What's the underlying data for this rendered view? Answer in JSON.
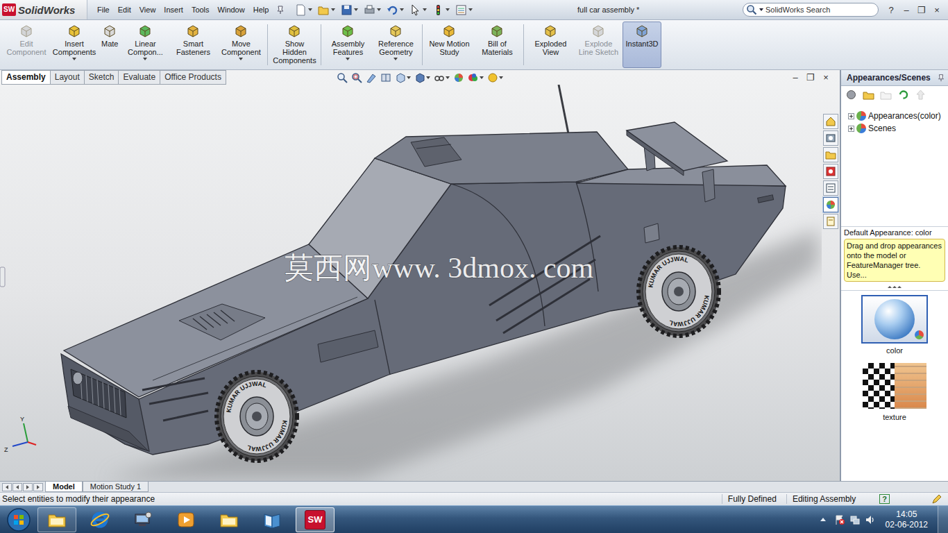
{
  "app": {
    "logo": "SolidWorks",
    "badge": "SW"
  },
  "menu": [
    "File",
    "Edit",
    "View",
    "Insert",
    "Tools",
    "Window",
    "Help"
  ],
  "window": {
    "title": "full car assembly *"
  },
  "search": {
    "placeholder": "SolidWorks Search"
  },
  "title_controls": [
    "?",
    "–",
    "❐",
    "×"
  ],
  "commands": [
    {
      "label": "Edit Component",
      "group": 1,
      "dropdown": false,
      "disabled": true,
      "selected": false
    },
    {
      "label": "Insert Components",
      "group": 1,
      "dropdown": true,
      "disabled": false,
      "selected": false
    },
    {
      "label": "Mate",
      "group": 1,
      "dropdown": false,
      "disabled": false,
      "selected": false
    },
    {
      "label": "Linear Compon...",
      "group": 1,
      "dropdown": true,
      "disabled": false,
      "selected": false
    },
    {
      "label": "Smart Fasteners",
      "group": 1,
      "dropdown": false,
      "disabled": false,
      "selected": false
    },
    {
      "label": "Move Component",
      "group": 1,
      "dropdown": true,
      "disabled": false,
      "selected": false
    },
    {
      "label": "Show Hidden Components",
      "group": 2,
      "dropdown": false,
      "disabled": false,
      "selected": false
    },
    {
      "label": "Assembly Features",
      "group": 3,
      "dropdown": true,
      "disabled": false,
      "selected": false
    },
    {
      "label": "Reference Geometry",
      "group": 3,
      "dropdown": true,
      "disabled": false,
      "selected": false
    },
    {
      "label": "New Motion Study",
      "group": 4,
      "dropdown": false,
      "disabled": false,
      "selected": false
    },
    {
      "label": "Bill of Materials",
      "group": 4,
      "dropdown": false,
      "disabled": false,
      "selected": false
    },
    {
      "label": "Exploded View",
      "group": 5,
      "dropdown": false,
      "disabled": false,
      "selected": false
    },
    {
      "label": "Explode Line Sketch",
      "group": 5,
      "dropdown": false,
      "disabled": true,
      "selected": false
    },
    {
      "label": "Instant3D",
      "group": 5,
      "dropdown": false,
      "disabled": false,
      "selected": true
    }
  ],
  "tabs": [
    {
      "label": "Assembly",
      "selected": true
    },
    {
      "label": "Layout",
      "selected": false
    },
    {
      "label": "Sketch",
      "selected": false
    },
    {
      "label": "Evaluate",
      "selected": false
    },
    {
      "label": "Office Products",
      "selected": false
    }
  ],
  "viewport": {
    "controls": [
      "–",
      "❐",
      "×"
    ],
    "watermark": "莫西网www. 3dmox. com",
    "tire_text": "KUMAR UJJWAL",
    "axes": [
      "Y",
      "Z"
    ]
  },
  "task_tabs": [
    {
      "selected": false
    },
    {
      "selected": false
    },
    {
      "selected": false
    },
    {
      "selected": false
    },
    {
      "selected": false
    },
    {
      "selected": true
    },
    {
      "selected": false
    }
  ],
  "task_pane": {
    "title": "Appearances/Scenes",
    "tree": [
      {
        "label": "Appearances(color)",
        "expanded": false
      },
      {
        "label": "Scenes",
        "expanded": false
      }
    ],
    "caption": "Default Appearance: color",
    "tooltip": "Drag and drop appearances onto the model or FeatureManager tree.  Use...",
    "gallery": [
      {
        "label": "color",
        "selected": true
      },
      {
        "label": "texture",
        "selected": false
      }
    ]
  },
  "bottom_tabs": [
    {
      "label": "Model",
      "selected": true
    },
    {
      "label": "Motion Study 1",
      "selected": false
    }
  ],
  "status_bar": {
    "message": "Select entities to modify their appearance",
    "fields": [
      "Fully Defined",
      "Editing Assembly"
    ],
    "help": "?"
  },
  "taskbar": {
    "apps": [
      {
        "running": true,
        "active": false
      },
      {
        "running": false,
        "active": false
      },
      {
        "running": false,
        "active": false
      },
      {
        "running": false,
        "active": false
      },
      {
        "running": false,
        "active": false
      },
      {
        "running": false,
        "active": false
      },
      {
        "running": true,
        "active": true
      }
    ],
    "time": "14:05",
    "date": "02-06-2012"
  }
}
